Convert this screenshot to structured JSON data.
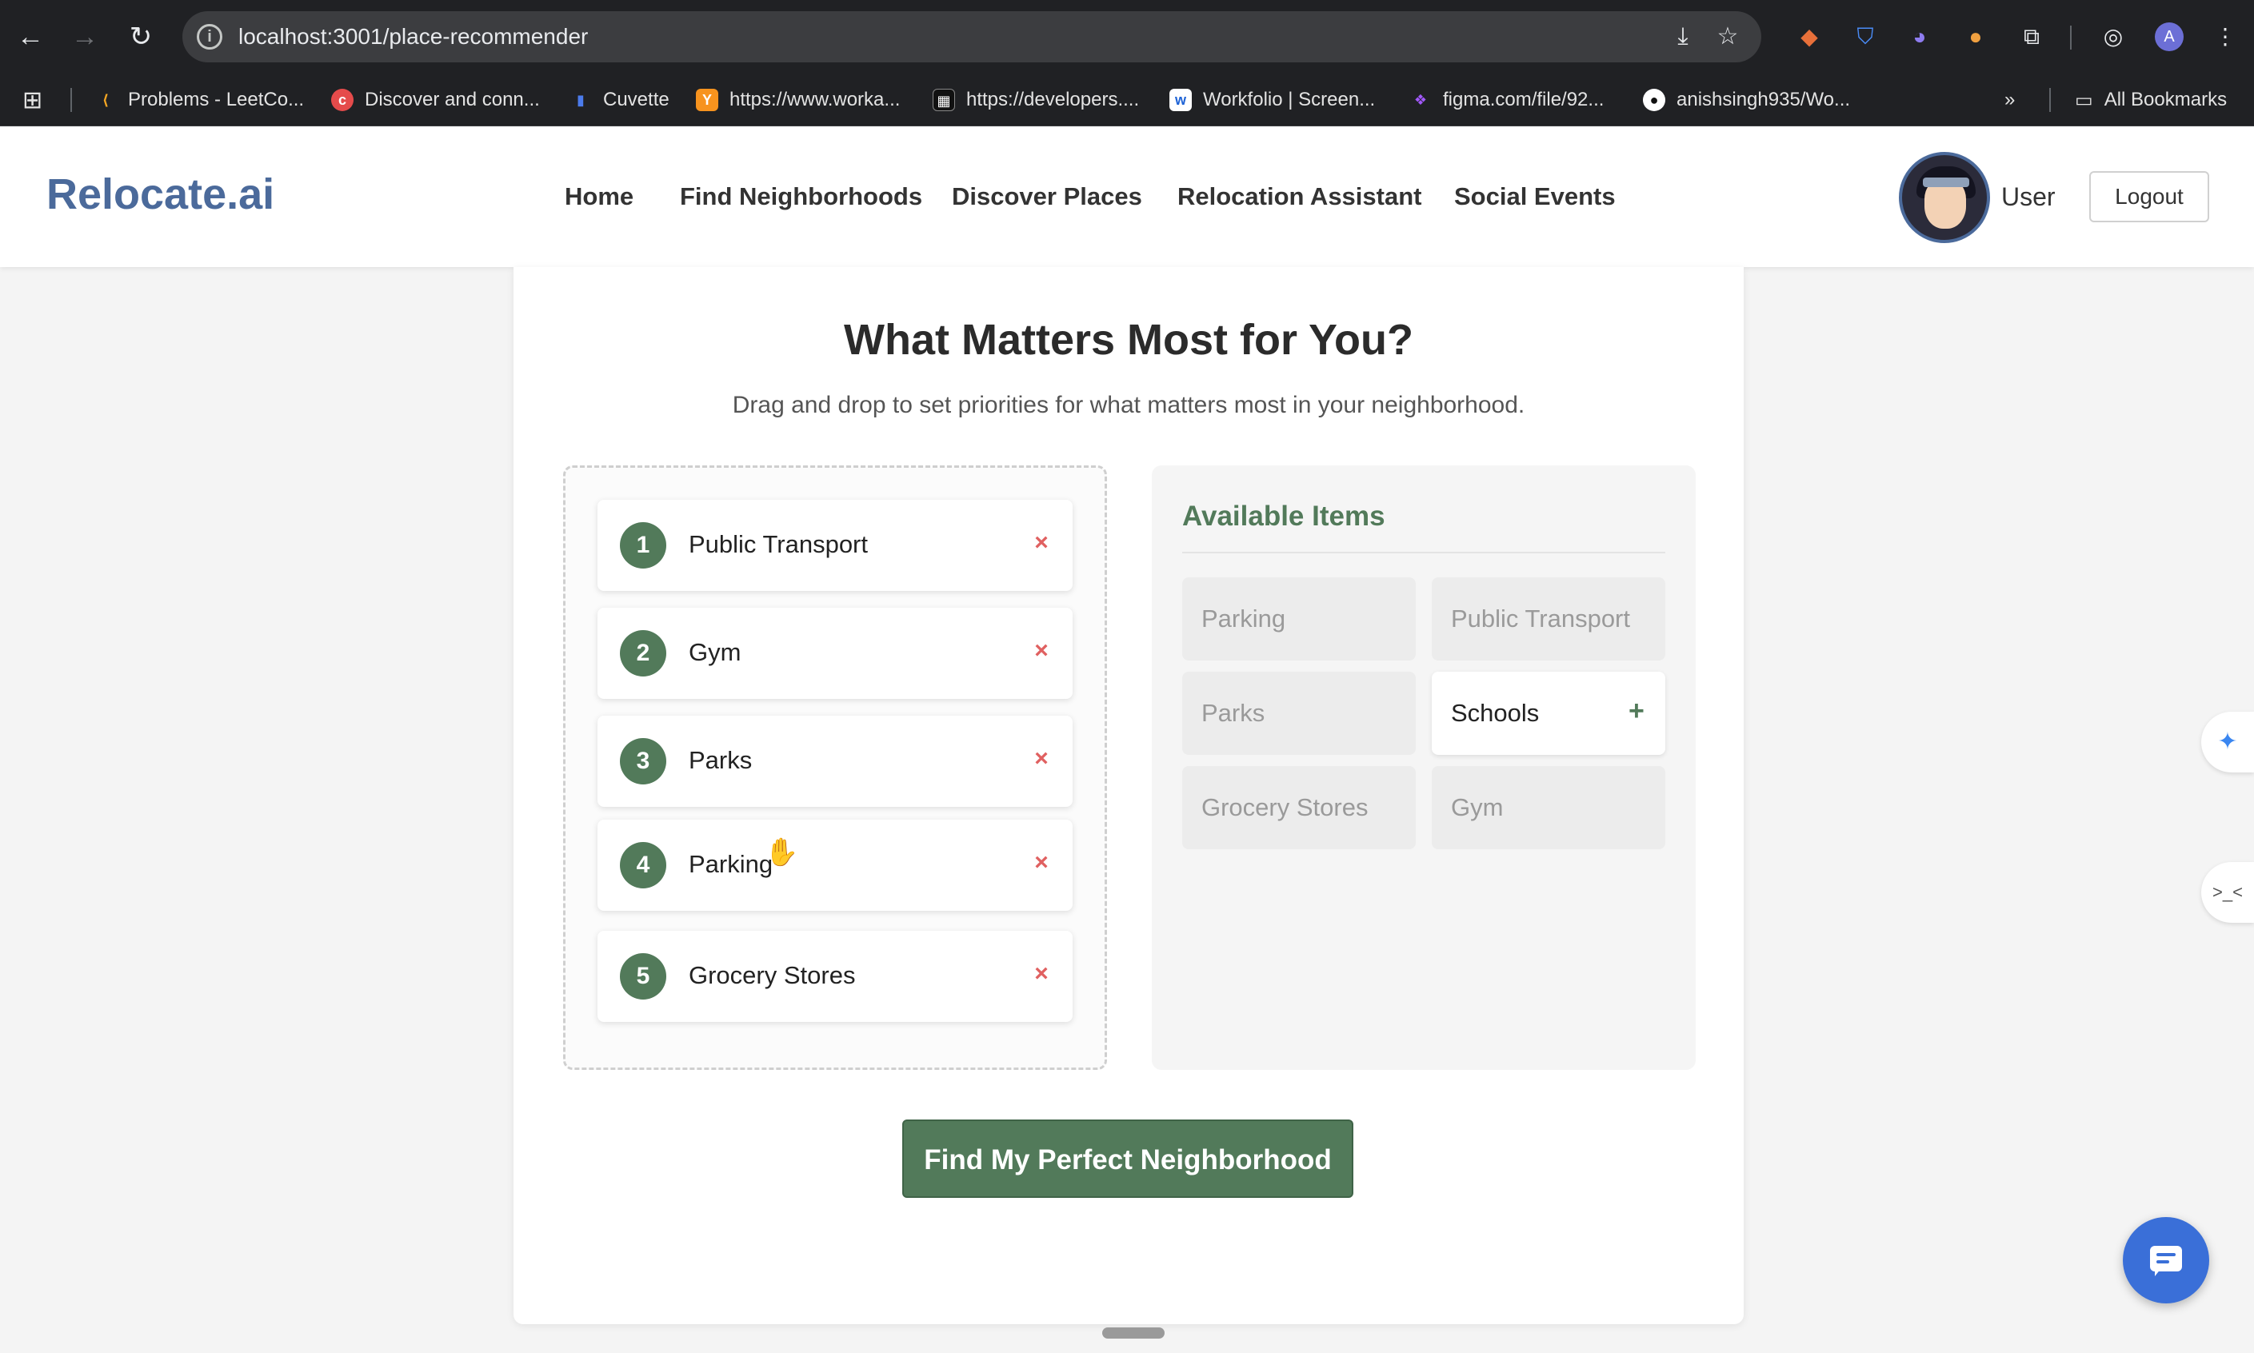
{
  "browser": {
    "url": "localhost:3001/place-recommender",
    "bookmarks": [
      {
        "label": "Problems - LeetCo...",
        "color": "#f5a623"
      },
      {
        "label": "Discover and conn...",
        "color": "#e54b4b"
      },
      {
        "label": "Cuvette",
        "color": "#4b7bec"
      },
      {
        "label": "https://www.worka...",
        "color": "#f7931e"
      },
      {
        "label": "https://developers....",
        "color": "#111111"
      },
      {
        "label": "Workfolio | Screen...",
        "color": "#1e63d6"
      },
      {
        "label": "figma.com/file/92...",
        "color": "#a259ff"
      },
      {
        "label": "anishsingh935/Wo...",
        "color": "#ffffff"
      }
    ],
    "all_bookmarks": "All Bookmarks",
    "profile_initial": "A"
  },
  "header": {
    "logo": "Relocate.ai",
    "nav": [
      "Home",
      "Find Neighborhoods",
      "Discover Places",
      "Relocation Assistant",
      "Social Events"
    ],
    "username": "User",
    "logout": "Logout"
  },
  "main": {
    "title": "What Matters Most for You?",
    "subtitle": "Drag and drop to set priorities for what matters most in your neighborhood.",
    "priorities": [
      {
        "rank": "1",
        "label": "Public Transport",
        "remove": "×"
      },
      {
        "rank": "2",
        "label": "Gym",
        "remove": "×"
      },
      {
        "rank": "3",
        "label": "Parks",
        "remove": "×"
      },
      {
        "rank": "4",
        "label": "Parking",
        "remove": "×"
      },
      {
        "rank": "5",
        "label": "Grocery Stores",
        "remove": "×"
      }
    ],
    "available_title": "Available Items",
    "available": [
      {
        "label": "Parking"
      },
      {
        "label": "Public Transport"
      },
      {
        "label": "Parks"
      },
      {
        "label": "Schools",
        "add": "+"
      },
      {
        "label": "Grocery Stores"
      },
      {
        "label": "Gym"
      }
    ],
    "cta": "Find My Perfect Neighborhood"
  },
  "colors": {
    "accent_green": "#527a5a",
    "logo_blue": "#4b6a9b",
    "remove_red": "#e06060",
    "chat_blue": "#3a6fd8"
  }
}
